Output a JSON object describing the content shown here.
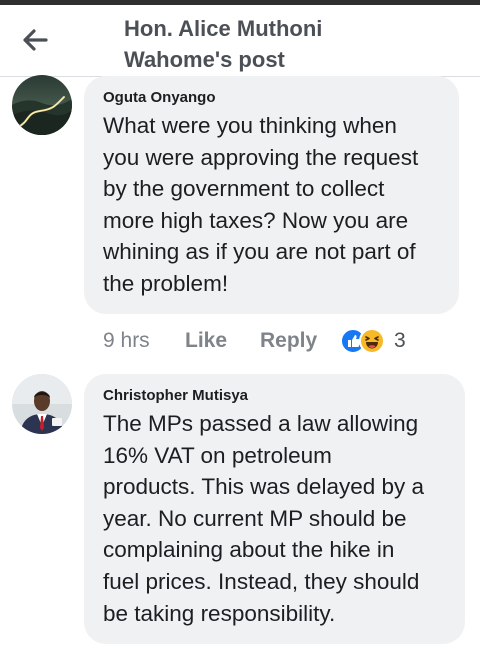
{
  "header": {
    "back_icon": "arrow-left-icon",
    "title_line1": "Hon. Alice Muthoni",
    "title_line2": "Wahome's post"
  },
  "comments": [
    {
      "author": "Oguta Onyango",
      "avatar_icon": "landscape-road-avatar",
      "text": "What were you thinking when\nyou were approving the request\nby the government to collect\nmore high taxes? Now you are\nwhining as if you are not part of\nthe problem!",
      "time": "9 hrs",
      "like_label": "Like",
      "reply_label": "Reply",
      "reactions": [
        "like-reaction-icon",
        "haha-reaction-icon"
      ],
      "reaction_count": "3"
    },
    {
      "author": "Christopher Mutisya",
      "avatar_icon": "person-suit-avatar",
      "text": "The MPs passed a law allowing\n16% VAT on petroleum\nproducts. This was delayed by a\nyear. No current MP should be\ncomplaining about the hike in\nfuel prices. Instead, they should\nbe taking responsibility."
    }
  ],
  "colors": {
    "bubble": "#f0f1f3",
    "like_blue": "#1877f2",
    "haha_yellow": "#f7b928",
    "meta_gray": "#7f838a"
  }
}
